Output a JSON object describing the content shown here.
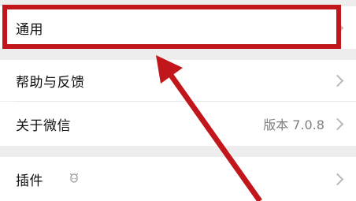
{
  "settings": {
    "general": {
      "label": "通用"
    },
    "help": {
      "label": "帮助与反馈"
    },
    "about": {
      "label": "关于微信",
      "version": "版本 7.0.8"
    },
    "plugins": {
      "label": "插件"
    }
  },
  "annotation": {
    "highlight_color": "#c1171c",
    "arrow_color": "#c1171c"
  },
  "icons": {
    "chevron": "chevron-right-icon",
    "plugin": "plugin-icon"
  }
}
